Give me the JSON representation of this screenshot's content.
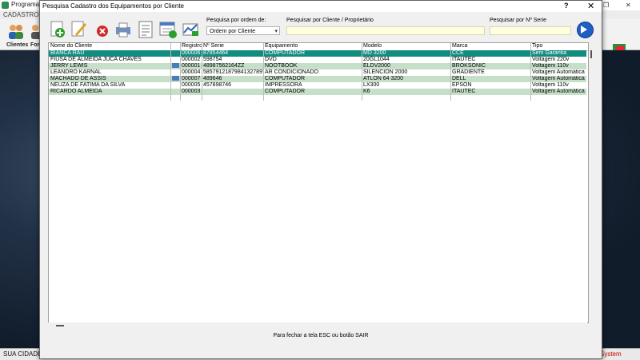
{
  "background_app": {
    "title": "Programa",
    "menu": "CADASTROS",
    "toolbar_labels": [
      "Clientes",
      "For"
    ],
    "status_left": "SUA CIDADE -",
    "status_right": "System"
  },
  "dialog": {
    "title": "Pesquisa Cadastro dos Equipamentos por Cliente",
    "help": "?",
    "close": "✕",
    "search_order_label": "Pesquisa por ordem de:",
    "search_order_value": "Ordem por Cliente",
    "search_client_label": "Pesquisar por Cliente / Proprietário",
    "search_client_value": "",
    "search_serial_label": "Pesquisar por Nº Serie",
    "search_serial_value": "",
    "footer": "Para fechar a tela ESC ou botão SAIR"
  },
  "columns": [
    "Nome do Cliente",
    "Registro",
    "Nº Serie",
    "Equipamento",
    "Modelo",
    "Marca",
    "Tipo"
  ],
  "rows": [
    {
      "cliente": "BIANCA RAU",
      "registro": "000006",
      "serie": "87854464",
      "equip": "COMPUTADOR",
      "modelo": "MD 3200",
      "marca": "CCE",
      "tipo": "Sem Garantia",
      "icon": false
    },
    {
      "cliente": "FIUSA DE ALMEIDA JUCA CHAVES",
      "registro": "000002",
      "serie": "598754",
      "equip": "DVD",
      "modelo": "20GL1044",
      "marca": "ITAUTEC",
      "tipo": "Voltagem 220v",
      "icon": false
    },
    {
      "cliente": "JERRY LEWIS",
      "registro": "000001",
      "serie": "48987562164ZZ",
      "equip": "NOOTBOOK",
      "modelo": "ELDV2000",
      "marca": "BROKSONIC",
      "tipo": "Voltagem 110v",
      "icon": true
    },
    {
      "cliente": "LEANDRO KARNAL",
      "registro": "000004",
      "serie": "5857912187984132789T",
      "equip": "AR CONDICIONADO",
      "modelo": "SILENCION 2000",
      "marca": "GRADIENTE",
      "tipo": "Voltagem Automática",
      "icon": false
    },
    {
      "cliente": "MACHADO DE ASSIS",
      "registro": "000007",
      "serie": "489646",
      "equip": "COMPUTADOR",
      "modelo": "ATLON 64 3200",
      "marca": "DELL",
      "tipo": "Voltagem Automática",
      "icon": true
    },
    {
      "cliente": "NEUZA DE FATIMA DA SILVA",
      "registro": "000005",
      "serie": "457898746",
      "equip": "IMPRESSORA",
      "modelo": "LX300",
      "marca": "EPSON",
      "tipo": "Voltagem 110v",
      "icon": false
    },
    {
      "cliente": "RICARDO ALMEIDA",
      "registro": "000003",
      "serie": "",
      "equip": "COMPUTADOR",
      "modelo": "K6",
      "marca": "ITAUTEC",
      "tipo": "Voltagem Automática",
      "icon": false
    }
  ],
  "colors": {
    "selected_row": "#138c80",
    "alt_row": "#c5dfc9",
    "search_input_bg": "#ffffe0",
    "go_button": "#1e5fc4"
  },
  "icons": {
    "toolbar": [
      "add-icon",
      "edit-icon",
      "delete-icon",
      "print-icon",
      "report-icon",
      "list-add-icon",
      "chart-icon"
    ],
    "go": "arrow-right-icon"
  }
}
